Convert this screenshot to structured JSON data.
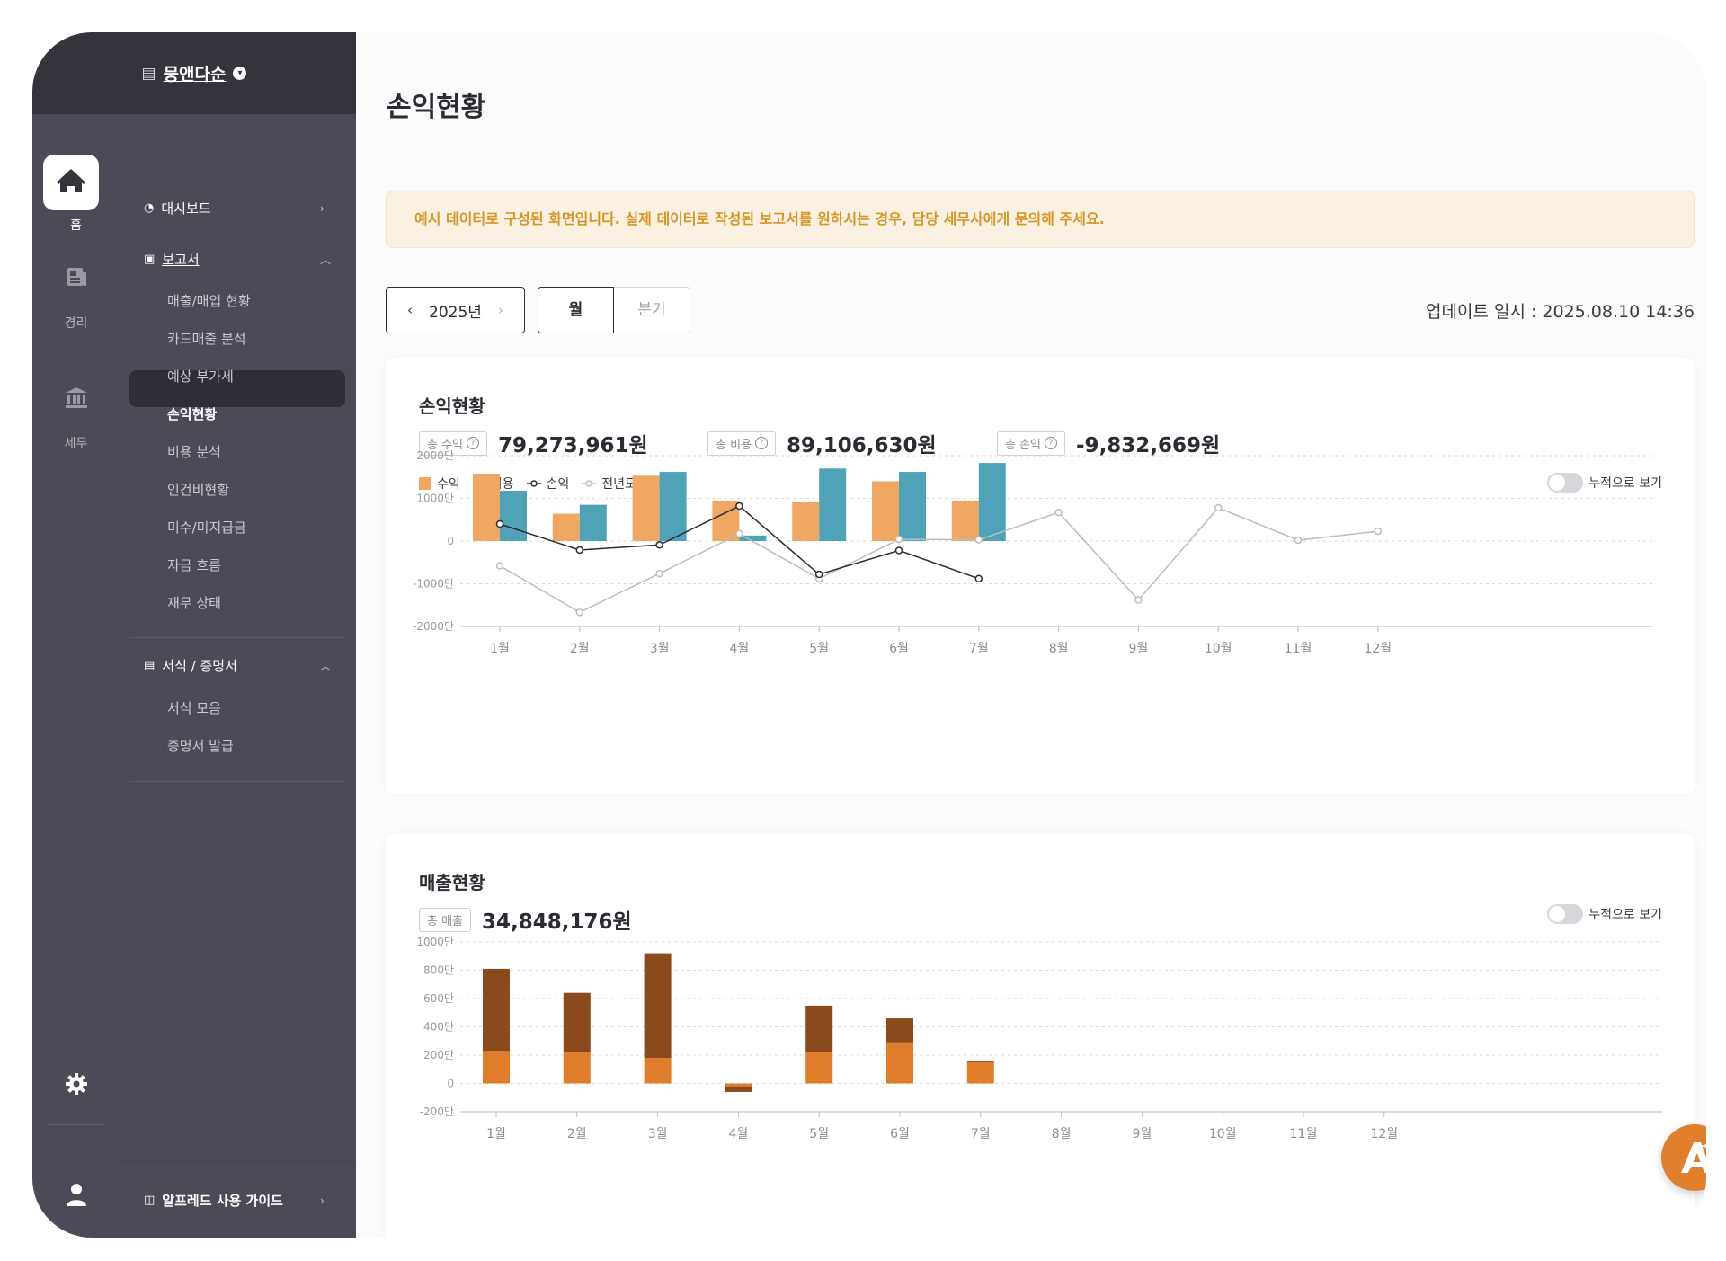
{
  "org": {
    "name": "뭉앤다순"
  },
  "rail": {
    "items": [
      {
        "label": "홈",
        "icon": "home-icon"
      },
      {
        "label": "경리",
        "icon": "ledger-icon"
      },
      {
        "label": "세무",
        "icon": "bank-icon"
      }
    ],
    "settings_icon": "gear-icon",
    "profile_icon": "user-icon"
  },
  "menu": {
    "dashboard": "대시보드",
    "reports": "보고서",
    "report_items": [
      "매출/매입 현황",
      "카드매출 분석",
      "예상 부가세",
      "손익현황",
      "비용 분석",
      "인건비현황",
      "미수/미지급금",
      "자금 흐름",
      "재무 상태"
    ],
    "active_item": "손익현황",
    "forms": "서식 / 증명서",
    "form_items": [
      "서식 모음",
      "증명서 발급"
    ],
    "guide": "알프레드 사용 가이드"
  },
  "page": {
    "title": "손익현황",
    "notice": "예시 데이터로 구성된 화면입니다. 실제 데이터로 작성된 보고서를 원하시는 경우, 담당 세무사에게 문의해 주세요.",
    "year": "2025년",
    "period_month": "월",
    "period_quarter": "분기",
    "updated": "업데이트 일시 : 2025.08.10 14:36"
  },
  "pl_card": {
    "title": "손익현황",
    "kpis": [
      {
        "label": "총 수익",
        "value": "79,273,961원"
      },
      {
        "label": "총 비용",
        "value": "89,106,630원"
      },
      {
        "label": "총 손익",
        "value": "-9,832,669원"
      }
    ],
    "legend": [
      "수익",
      "비용",
      "손익",
      "전년도 손익"
    ],
    "toggle": "누적으로 보기"
  },
  "sales_card": {
    "title": "매출현황",
    "kpis": [
      {
        "label": "총 매출",
        "value": "34,848,176원"
      }
    ],
    "toggle": "누적으로 보기"
  },
  "colors": {
    "revenue": "#f0a761",
    "expense": "#4fa3b8",
    "profit": "#2b2b33",
    "prev_profit": "#bdbdbd",
    "sales_dark": "#8a4a1c",
    "sales_light": "#e07d2b"
  },
  "chart_data": [
    {
      "type": "bar",
      "categories": [
        "1월",
        "2월",
        "3월",
        "4월",
        "5월",
        "6월",
        "7월",
        "8월",
        "9월",
        "10월",
        "11월",
        "12월"
      ],
      "ylim": [
        -2000,
        2000
      ],
      "yticks": [
        "2000만",
        "1000만",
        "0",
        "-1000만",
        "-2000만"
      ],
      "ytick_values": [
        2000,
        1000,
        0,
        -1000,
        -2000
      ],
      "series": [
        {
          "name": "수익",
          "kind": "bar",
          "values": [
            1580,
            640,
            1530,
            950,
            920,
            1400,
            950,
            null,
            null,
            null,
            null,
            null
          ]
        },
        {
          "name": "비용",
          "kind": "bar",
          "values": [
            1180,
            850,
            1620,
            130,
            1700,
            1620,
            1830,
            null,
            null,
            null,
            null,
            null
          ]
        },
        {
          "name": "손익",
          "kind": "line",
          "values": [
            400,
            -210,
            -90,
            820,
            -780,
            -220,
            -880,
            null,
            null,
            null,
            null,
            null
          ]
        },
        {
          "name": "전년도 손익",
          "kind": "line",
          "values": [
            -580,
            -1670,
            -760,
            170,
            -880,
            40,
            30,
            670,
            -1380,
            780,
            20,
            230
          ]
        }
      ]
    },
    {
      "type": "bar",
      "stacked": true,
      "categories": [
        "1월",
        "2월",
        "3월",
        "4월",
        "5월",
        "6월",
        "7월",
        "8월",
        "9월",
        "10월",
        "11월",
        "12월"
      ],
      "ylim": [
        -200,
        1000
      ],
      "yticks": [
        "1000만",
        "800만",
        "600만",
        "400만",
        "200만",
        "0",
        "-200만"
      ],
      "ytick_values": [
        1000,
        800,
        600,
        400,
        200,
        0,
        -200
      ],
      "series": [
        {
          "name": "series-light",
          "values": [
            230,
            220,
            180,
            -20,
            220,
            290,
            150,
            null,
            null,
            null,
            null,
            null
          ]
        },
        {
          "name": "series-dark",
          "values": [
            580,
            420,
            740,
            -40,
            330,
            170,
            10,
            null,
            null,
            null,
            null,
            null
          ]
        }
      ]
    }
  ]
}
